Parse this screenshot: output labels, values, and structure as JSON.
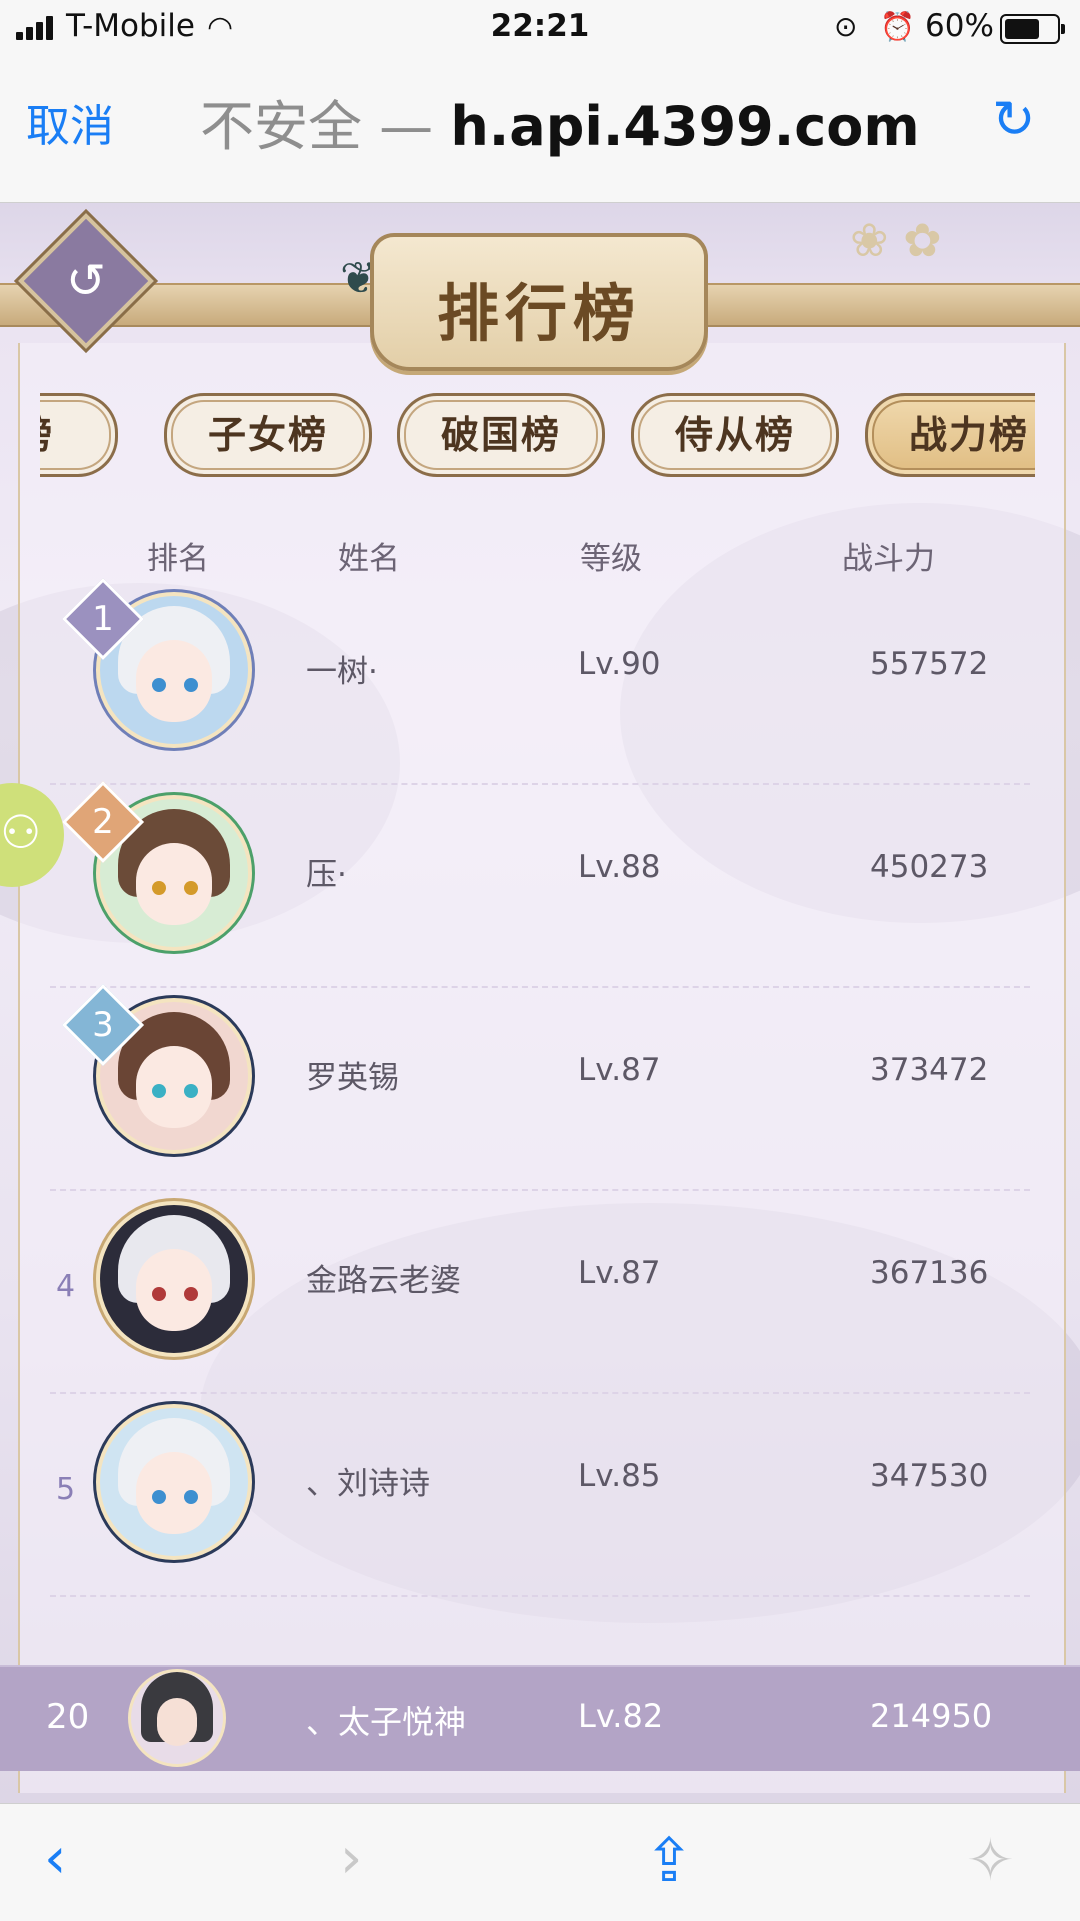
{
  "status_bar": {
    "carrier": "T-Mobile",
    "time": "22:21",
    "battery": "60%",
    "battery_level": 0.6
  },
  "url_bar": {
    "cancel": "取消",
    "insecure": "不安全 —",
    "host": "h.api.4399.com"
  },
  "game": {
    "title": "排行榜",
    "tabs": [
      {
        "label": "府榜",
        "active": false
      },
      {
        "label": "子女榜",
        "active": false
      },
      {
        "label": "破国榜",
        "active": false
      },
      {
        "label": "侍从榜",
        "active": false
      },
      {
        "label": "战力榜",
        "active": true
      }
    ],
    "columns": {
      "rank": "排名",
      "name": "姓名",
      "level": "等级",
      "power": "战斗力"
    },
    "rows": [
      {
        "rank": "1",
        "name": "一树·",
        "level": "Lv.90",
        "power": "557572"
      },
      {
        "rank": "2",
        "name": "压·",
        "level": "Lv.88",
        "power": "450273"
      },
      {
        "rank": "3",
        "name": "罗英锡",
        "level": "Lv.87",
        "power": "373472"
      },
      {
        "rank": "4",
        "name": "金路云老婆",
        "level": "Lv.87",
        "power": "367136"
      },
      {
        "rank": "5",
        "name": "、刘诗诗",
        "level": "Lv.85",
        "power": "347530"
      }
    ],
    "my_rank": {
      "rank": "20",
      "name": "、太子悦神",
      "level": "Lv.82",
      "power": "214950"
    }
  },
  "toolbar": {
    "back": "‹",
    "forward": "›",
    "share": "⇪",
    "compass": "✧"
  }
}
